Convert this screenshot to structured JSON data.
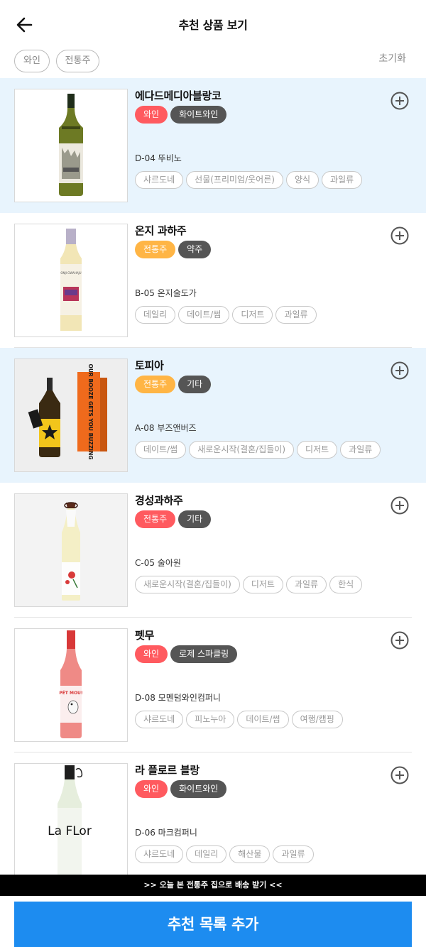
{
  "header": {
    "title": "추천 상품 보기",
    "back_icon": "arrow-left-icon"
  },
  "filters": {
    "chips": [
      "와인",
      "전통주"
    ],
    "reset": "초기화"
  },
  "products": [
    {
      "name": "에다드메디아블랑코",
      "badges": [
        {
          "label": "와인",
          "color": "#ff5a5f"
        },
        {
          "label": "화이트와인",
          "color": "#555555"
        }
      ],
      "seller": "D-04 뚜비노",
      "tags": [
        "샤르도네",
        "선물(프리미엄/웃어른)",
        "양식",
        "과일류"
      ],
      "highlighted": true
    },
    {
      "name": "온지 과하주",
      "badges": [
        {
          "label": "전통주",
          "color": "#ffb545"
        },
        {
          "label": "약주",
          "color": "#555555"
        }
      ],
      "seller": "B-05 온지술도가",
      "tags": [
        "데일리",
        "데이트/썸",
        "디저트",
        "과일류"
      ],
      "highlighted": false
    },
    {
      "name": "토피아",
      "badges": [
        {
          "label": "전통주",
          "color": "#ffb545"
        },
        {
          "label": "기타",
          "color": "#555555"
        }
      ],
      "seller": "A-08 부즈앤버즈",
      "tags": [
        "데이트/썸",
        "새로운시작(결혼/집들이)",
        "디저트",
        "과일류"
      ],
      "highlighted": true
    },
    {
      "name": "경성과하주",
      "badges": [
        {
          "label": "전통주",
          "color": "#ff5a5f"
        },
        {
          "label": "기타",
          "color": "#555555"
        }
      ],
      "seller": "C-05 술아원",
      "tags": [
        "새로운시작(결혼/집들이)",
        "디저트",
        "과일류",
        "한식"
      ],
      "highlighted": false
    },
    {
      "name": "펫무",
      "badges": [
        {
          "label": "와인",
          "color": "#ff5a5f"
        },
        {
          "label": "로제 스파클링",
          "color": "#555555"
        }
      ],
      "seller": "D-08 모멘텀와인컴퍼니",
      "tags": [
        "샤르도네",
        "피노누아",
        "데이트/썸",
        "여행/캠핑"
      ],
      "highlighted": false
    },
    {
      "name": "라 플로르 블랑",
      "badges": [
        {
          "label": "와인",
          "color": "#ff5a5f"
        },
        {
          "label": "화이트와인",
          "color": "#555555"
        }
      ],
      "seller": "D-06 마크컴퍼니",
      "tags": [
        "샤르도네",
        "데일리",
        "해산물",
        "과일류"
      ],
      "highlighted": false
    }
  ],
  "product_label_texts": {
    "topia_box": "OUR BOOZE GETS YOU BUZZING",
    "onji_bottle": "ONJI GWAHAJU",
    "petmou_bottle": "PÉT MOU!",
    "laflor_bottle": "La FLor"
  },
  "banner": ">> 오늘 본 전통주 집으로 배송 받기 <<",
  "cta": "추천 목록 추가",
  "colors": {
    "highlight_bg": "#e8f4fd",
    "cta_bg": "#1d8cf0",
    "wine_badge": "#ff5a5f",
    "traditional_badge": "#ffb545",
    "category_badge": "#555555"
  }
}
